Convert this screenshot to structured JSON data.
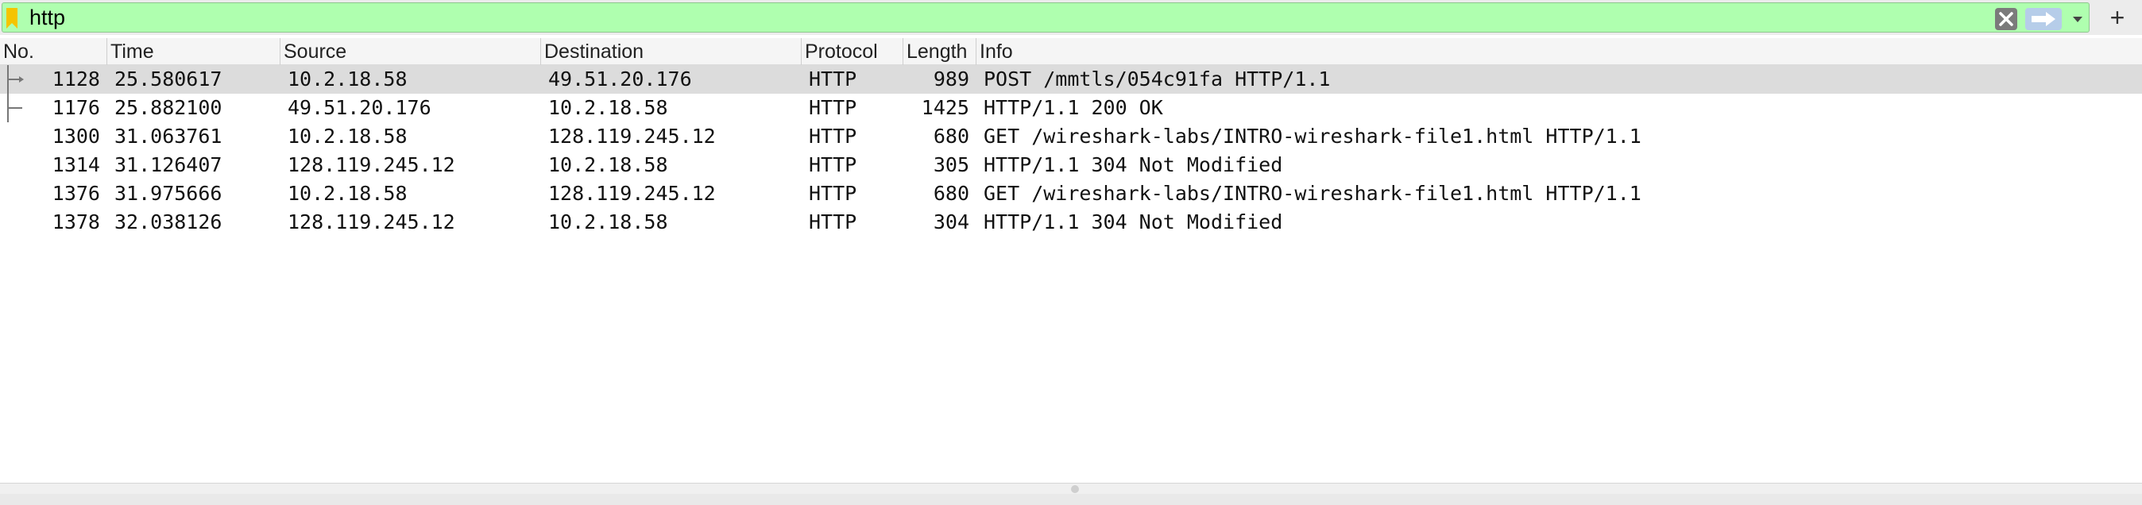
{
  "filter": {
    "value": "http",
    "clear_icon": "clear-icon",
    "apply_icon": "arrow-right-icon",
    "dropdown_icon": "chevron-down-icon",
    "add_label": "+"
  },
  "columns": [
    "No.",
    "Time",
    "Source",
    "Destination",
    "Protocol",
    "Length",
    "Info"
  ],
  "packets": [
    {
      "no": "1128",
      "time": "25.580617",
      "source": "10.2.18.58",
      "destination": "49.51.20.176",
      "protocol": "HTTP",
      "length": "989",
      "info": "POST /mmtls/054c91fa HTTP/1.1"
    },
    {
      "no": "1176",
      "time": "25.882100",
      "source": "49.51.20.176",
      "destination": "10.2.18.58",
      "protocol": "HTTP",
      "length": "1425",
      "info": "HTTP/1.1 200 OK"
    },
    {
      "no": "1300",
      "time": "31.063761",
      "source": "10.2.18.58",
      "destination": "128.119.245.12",
      "protocol": "HTTP",
      "length": "680",
      "info": "GET /wireshark-labs/INTRO-wireshark-file1.html HTTP/1.1"
    },
    {
      "no": "1314",
      "time": "31.126407",
      "source": "128.119.245.12",
      "destination": "10.2.18.58",
      "protocol": "HTTP",
      "length": "305",
      "info": "HTTP/1.1 304 Not Modified"
    },
    {
      "no": "1376",
      "time": "31.975666",
      "source": "10.2.18.58",
      "destination": "128.119.245.12",
      "protocol": "HTTP",
      "length": "680",
      "info": "GET /wireshark-labs/INTRO-wireshark-file1.html HTTP/1.1"
    },
    {
      "no": "1378",
      "time": "32.038126",
      "source": "128.119.245.12",
      "destination": "10.2.18.58",
      "protocol": "HTTP",
      "length": "304",
      "info": "HTTP/1.1 304 Not Modified"
    }
  ],
  "selected_row": 0,
  "colors": {
    "filter_valid": "#afffaf",
    "selected_row": "#dcdcdc",
    "bookmark": "#f5c400"
  }
}
